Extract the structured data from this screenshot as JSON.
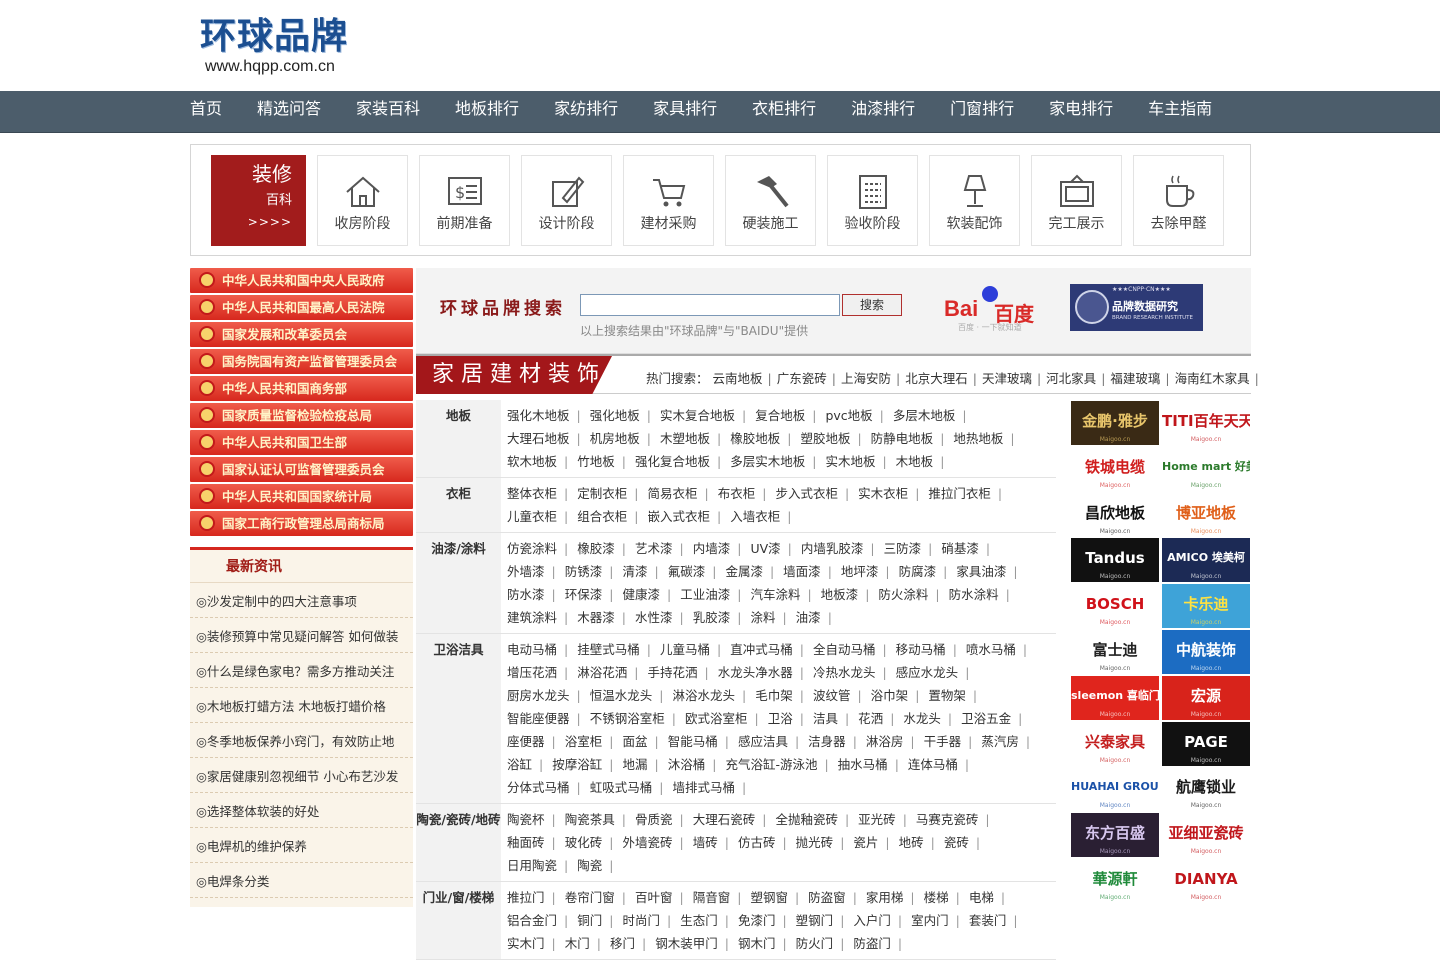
{
  "header": {
    "logo_text": "环球品牌",
    "logo_url": "www.hqpp.com.cn"
  },
  "nav": [
    "首页",
    "精选问答",
    "家装百科",
    "地板排行",
    "家纺排行",
    "家具排行",
    "衣柜排行",
    "油漆排行",
    "门窗排行",
    "家电排行",
    "车主指南"
  ],
  "deco": {
    "lead1": "装修",
    "lead2": "百科",
    "lead3": ">>>>",
    "tiles": [
      {
        "label": "收房阶段",
        "icon": "house-icon"
      },
      {
        "label": "前期准备",
        "icon": "money-board-icon"
      },
      {
        "label": "设计阶段",
        "icon": "design-pen-icon"
      },
      {
        "label": "建材采购",
        "icon": "shopping-cart-icon"
      },
      {
        "label": "硬装施工",
        "icon": "hammer-icon"
      },
      {
        "label": "验收阶段",
        "icon": "checklist-icon"
      },
      {
        "label": "软装配饰",
        "icon": "lamp-icon"
      },
      {
        "label": "完工展示",
        "icon": "tv-frame-icon"
      },
      {
        "label": "去除甲醛",
        "icon": "cup-icon"
      }
    ]
  },
  "gov_links": [
    "中华人民共和国中央人民政府",
    "中华人民共和国最高人民法院",
    "国家发展和改革委员会",
    "国务院国有资产监督管理委员会",
    "中华人民共和国商务部",
    "国家质量监督检验检疫总局",
    "中华人民共和国卫生部",
    "国家认证认可监督管理委员会",
    "中华人民共和国国家统计局",
    "国家工商行政管理总局商标局"
  ],
  "news": {
    "title": "最新资讯",
    "items": [
      "◎沙发定制中的四大注意事项",
      "◎装修预算中常见疑问解答 如何做装",
      "◎什么是绿色家电？需多方推动关注",
      "◎木地板打蜡方法 木地板打蜡价格",
      "◎冬季地板保养小窍门，有效防止地",
      "◎家居健康别忽视细节 小心布艺沙发",
      "◎选择整体软装的好处",
      "◎电焊机的维护保养",
      "◎电焊条分类"
    ]
  },
  "search": {
    "title": "环球品牌搜索",
    "button": "搜索",
    "note": "以上搜索结果由\"环球品牌\"与\"BAIDU\"提供",
    "placeholder": ""
  },
  "baidu": {
    "text": "Bai",
    "text2": "百度",
    "sub": "百度 · 一下就知道"
  },
  "brand_research": {
    "small": "★★★CNPP·CN★★★",
    "title": "品牌数据研究",
    "en": "BRAND RESEARCH INSTITUTE"
  },
  "section": {
    "title": "家居建材装饰",
    "hot_label": "热门搜索：",
    "hot": [
      "云南地板",
      "广东瓷砖",
      "上海安防",
      "北京大理石",
      "天津玻璃",
      "河北家具",
      "福建玻璃",
      "海南红木家具"
    ]
  },
  "categories": [
    {
      "name": "地板",
      "items": [
        "强化木地板",
        "强化地板",
        "实木复合地板",
        "复合地板",
        "pvc地板",
        "多层木地板",
        "大理石地板",
        "机房地板",
        "木塑地板",
        "橡胶地板",
        "塑胶地板",
        "防静电地板",
        "地热地板",
        "软木地板",
        "竹地板",
        "强化复合地板",
        "多层实木地板",
        "实木地板",
        "木地板"
      ]
    },
    {
      "name": "衣柜",
      "items": [
        "整体衣柜",
        "定制衣柜",
        "简易衣柜",
        "布衣柜",
        "步入式衣柜",
        "实木衣柜",
        "推拉门衣柜",
        "儿童衣柜",
        "组合衣柜",
        "嵌入式衣柜",
        "入墙衣柜"
      ]
    },
    {
      "name": "油漆/涂料",
      "items": [
        "仿瓷涂料",
        "橡胶漆",
        "艺术漆",
        "内墙漆",
        "UV漆",
        "内墙乳胶漆",
        "三防漆",
        "硝基漆",
        "外墙漆",
        "防锈漆",
        "清漆",
        "氟碳漆",
        "金属漆",
        "墙面漆",
        "地坪漆",
        "防腐漆",
        "家具油漆",
        "防水漆",
        "环保漆",
        "健康漆",
        "工业油漆",
        "汽车涂料",
        "地板漆",
        "防火涂料",
        "防水涂料",
        "建筑涂料",
        "木器漆",
        "水性漆",
        "乳胶漆",
        "涂料",
        "油漆"
      ]
    },
    {
      "name": "卫浴洁具",
      "items": [
        "电动马桶",
        "挂壁式马桶",
        "儿童马桶",
        "直冲式马桶",
        "全自动马桶",
        "移动马桶",
        "喷水马桶",
        "增压花洒",
        "淋浴花洒",
        "手持花洒",
        "水龙头净水器",
        "冷热水龙头",
        "感应水龙头",
        "厨房水龙头",
        "恒温水龙头",
        "淋浴水龙头",
        "毛巾架",
        "波纹管",
        "浴巾架",
        "置物架",
        "智能座便器",
        "不锈钢浴室柜",
        "欧式浴室柜",
        "卫浴",
        "洁具",
        "花洒",
        "水龙头",
        "卫浴五金",
        "座便器",
        "浴室柜",
        "面盆",
        "智能马桶",
        "感应洁具",
        "洁身器",
        "淋浴房",
        "干手器",
        "蒸汽房",
        "浴缸",
        "按摩浴缸",
        "地漏",
        "沐浴桶",
        "充气浴缸-游泳池",
        "抽水马桶",
        "连体马桶",
        "分体式马桶",
        "虹吸式马桶",
        "墙排式马桶"
      ]
    },
    {
      "name": "陶瓷/瓷砖/地砖",
      "items": [
        "陶瓷杯",
        "陶瓷茶具",
        "骨质瓷",
        "大理石瓷砖",
        "全抛釉瓷砖",
        "亚光砖",
        "马赛克瓷砖",
        "釉面砖",
        "玻化砖",
        "外墙瓷砖",
        "墙砖",
        "仿古砖",
        "抛光砖",
        "瓷片",
        "地砖",
        "瓷砖",
        "日用陶瓷",
        "陶瓷"
      ]
    },
    {
      "name": "门业/窗/楼梯",
      "items": [
        "推拉门",
        "卷帘门窗",
        "百叶窗",
        "隔音窗",
        "塑钢窗",
        "防盗窗",
        "家用梯",
        "楼梯",
        "电梯",
        "铝合金门",
        "铜门",
        "时尚门",
        "生态门",
        "免漆门",
        "塑钢门",
        "入户门",
        "室内门",
        "套装门",
        "实木门",
        "木门",
        "移门",
        "钢木装甲门",
        "钢木门",
        "防火门",
        "防盗门"
      ]
    }
  ],
  "brands": [
    {
      "text": "金鹏·雅步",
      "bg": "#3a2a15",
      "fg": "#e8c56b"
    },
    {
      "text": "TITI百年天天",
      "bg": "#ffffff",
      "fg": "#c0161b"
    },
    {
      "text": "铁城电缆",
      "bg": "#ffffff",
      "fg": "#d01d1d"
    },
    {
      "text": "Home mart 好美家",
      "bg": "#ffffff",
      "fg": "#2b7a2b"
    },
    {
      "text": "昌欣地板",
      "bg": "#ffffff",
      "fg": "#111111"
    },
    {
      "text": "博亚地板",
      "bg": "#ffffff",
      "fg": "#e0601a"
    },
    {
      "text": "Tandus",
      "bg": "#111111",
      "fg": "#ffffff"
    },
    {
      "text": "AMICO 埃美柯",
      "bg": "#1c2a55",
      "fg": "#ffffff"
    },
    {
      "text": "BOSCH",
      "bg": "#ffffff",
      "fg": "#d0121a"
    },
    {
      "text": "卡乐迪",
      "bg": "#3ea3d8",
      "fg": "#ffe241"
    },
    {
      "text": "富士迪",
      "bg": "#ffffff",
      "fg": "#222222"
    },
    {
      "text": "中航装饰",
      "bg": "#1c6cc2",
      "fg": "#ffffff"
    },
    {
      "text": "sleemon 喜临门",
      "bg": "#e0251d",
      "fg": "#ffffff"
    },
    {
      "text": "宏源",
      "bg": "#d8231b",
      "fg": "#ffffff"
    },
    {
      "text": "兴泰家具",
      "bg": "#ffffff",
      "fg": "#c42020"
    },
    {
      "text": "PAGE",
      "bg": "#111111",
      "fg": "#ffffff"
    },
    {
      "text": "HUAHAI GROUP",
      "bg": "#ffffff",
      "fg": "#1c52a8"
    },
    {
      "text": "航鹰锁业",
      "bg": "#ffffff",
      "fg": "#1b1b1b"
    },
    {
      "text": "东方百盛",
      "bg": "#2a1f33",
      "fg": "#d8c8f0"
    },
    {
      "text": "亚细亚瓷砖",
      "bg": "#ffffff",
      "fg": "#c0161b"
    },
    {
      "text": "華源軒",
      "bg": "#ffffff",
      "fg": "#1f8a3a"
    },
    {
      "text": "DIANYA",
      "bg": "#ffffff",
      "fg": "#c0161b"
    }
  ],
  "maigoo": "Maigoo.cn"
}
